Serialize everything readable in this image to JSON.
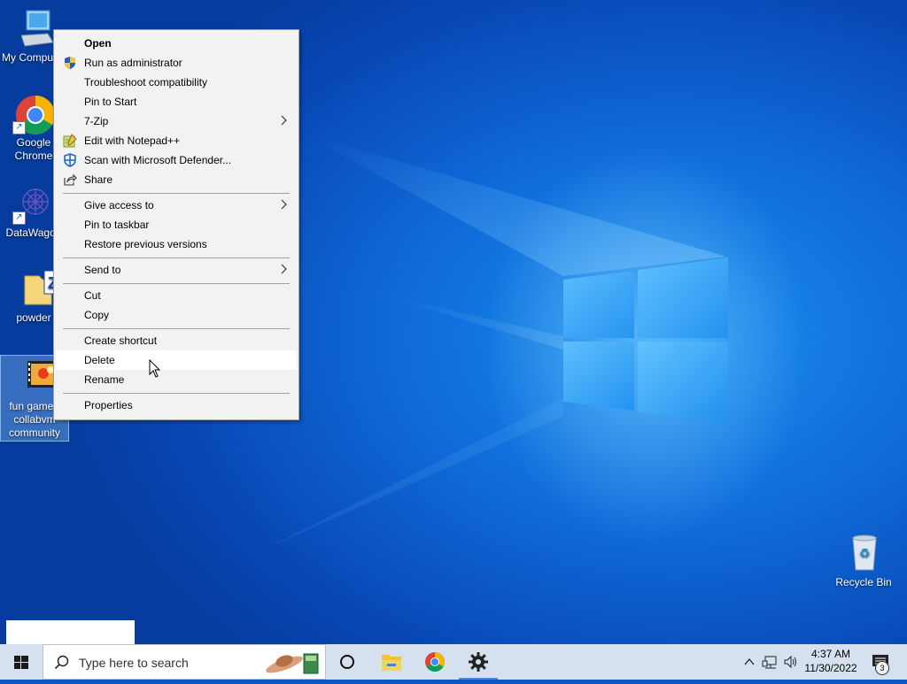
{
  "desktop_icons": [
    {
      "label": "My Computer",
      "icon": "computer-icon"
    },
    {
      "label": "Google Chrome",
      "icon": "chrome-icon"
    },
    {
      "label": "DataWagon",
      "icon": "datawagon-icon"
    },
    {
      "label": "powder",
      "icon": "zip-folder-icon"
    },
    {
      "label": "fun game - collabvm community",
      "icon": "video-file-icon"
    }
  ],
  "recycle_bin": {
    "label": "Recycle Bin"
  },
  "context_menu": {
    "items": [
      {
        "label": "Open",
        "bold": true
      },
      {
        "label": "Run as administrator",
        "icon": "shield-icon"
      },
      {
        "label": "Troubleshoot compatibility"
      },
      {
        "label": "Pin to Start"
      },
      {
        "label": "7-Zip",
        "submenu": true
      },
      {
        "label": "Edit with Notepad++",
        "icon": "notepadpp-icon"
      },
      {
        "label": "Scan with Microsoft Defender...",
        "icon": "defender-icon"
      },
      {
        "label": "Share",
        "icon": "share-icon"
      },
      {
        "label": "Give access to",
        "submenu": true
      },
      {
        "label": "Pin to taskbar"
      },
      {
        "label": "Restore previous versions"
      },
      {
        "label": "Send to",
        "submenu": true
      },
      {
        "label": "Cut"
      },
      {
        "label": "Copy"
      },
      {
        "label": "Create shortcut"
      },
      {
        "label": "Delete",
        "hovered": true
      },
      {
        "label": "Rename"
      },
      {
        "label": "Properties"
      }
    ]
  },
  "taskbar": {
    "search_placeholder": "Type here to search",
    "apps": [
      "cortana-icon",
      "file-explorer-icon",
      "chrome-icon",
      "settings-icon"
    ],
    "active_app": "settings-icon",
    "clock_time": "4:37 AM",
    "clock_date": "11/30/2022",
    "notification_count": "3"
  },
  "colors": {
    "accent": "#0078d7",
    "menu_bg": "#f2f2f2",
    "taskbar_bg": "#d5e1ee"
  }
}
